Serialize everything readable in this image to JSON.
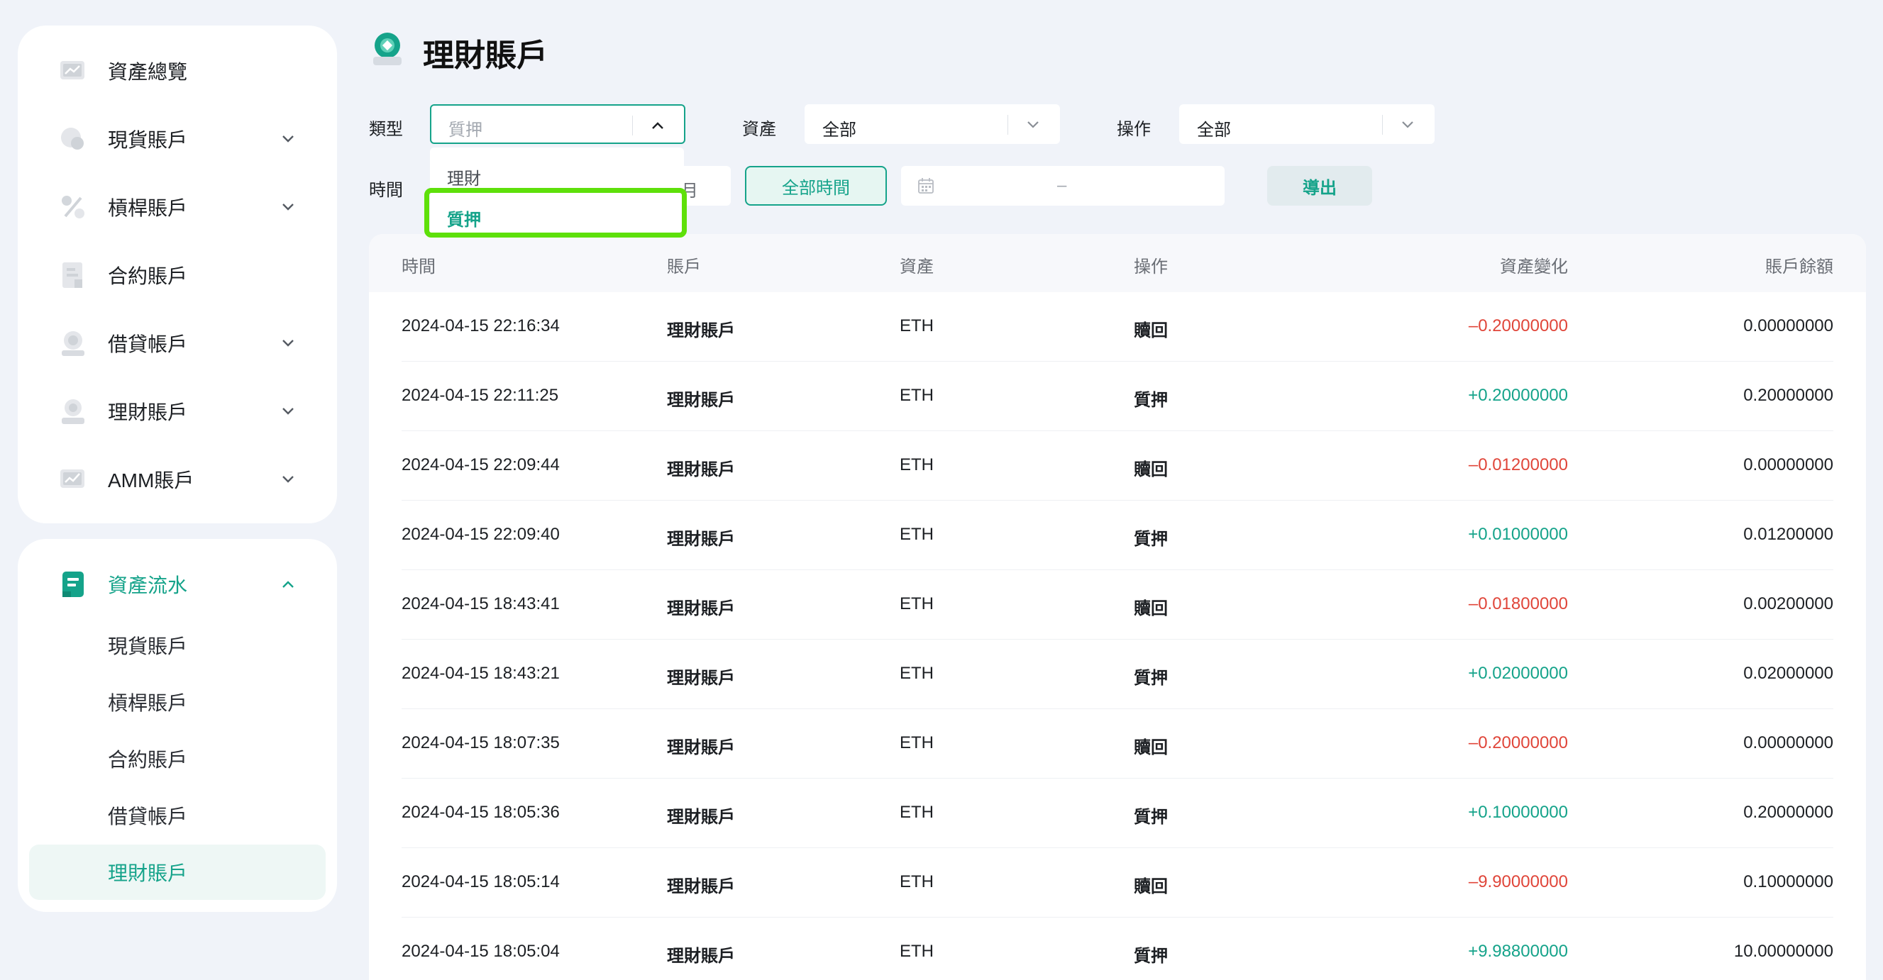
{
  "page": {
    "title": "理財賬戶"
  },
  "sidebar": {
    "top_items": [
      {
        "label": "資產總覽",
        "icon": "chart-board-icon",
        "has_chevron": false
      },
      {
        "label": "現貨賬戶",
        "icon": "coin-icon",
        "has_chevron": true
      },
      {
        "label": "槓桿賬戶",
        "icon": "percent-icon",
        "has_chevron": true
      },
      {
        "label": "合約賬戶",
        "icon": "document-icon",
        "has_chevron": false
      },
      {
        "label": "借貸帳戶",
        "icon": "lending-icon",
        "has_chevron": true
      },
      {
        "label": "理財賬戶",
        "icon": "wealth-icon",
        "has_chevron": true
      },
      {
        "label": "AMM賬戶",
        "icon": "amm-chart-icon",
        "has_chevron": true
      }
    ],
    "flow": {
      "label": "資產流水",
      "icon": "ledger-icon",
      "sub_items": [
        "現貨賬戶",
        "槓桿賬戶",
        "合約賬戶",
        "借貸帳戶",
        "理財賬戶"
      ],
      "active_sub": 4
    }
  },
  "filters": {
    "type_label": "類型",
    "type_value": "質押",
    "type_options": [
      "理財",
      "質押"
    ],
    "asset_label": "資產",
    "asset_value": "全部",
    "action_label": "操作",
    "action_value": "全部",
    "time_label": "時間",
    "month_partial": "月",
    "all_time_button": "全部時間",
    "date_separator": "–",
    "export_button": "導出"
  },
  "table": {
    "headers": [
      "時間",
      "賬戶",
      "資產",
      "操作",
      "資產變化",
      "賬戶餘額"
    ],
    "rows": [
      {
        "time": "2024-04-15 22:16:34",
        "account": "理財賬戶",
        "asset": "ETH",
        "action": "贖回",
        "change": "–0.20000000",
        "sign": "neg",
        "balance": "0.00000000"
      },
      {
        "time": "2024-04-15 22:11:25",
        "account": "理財賬戶",
        "asset": "ETH",
        "action": "質押",
        "change": "+0.20000000",
        "sign": "pos",
        "balance": "0.20000000"
      },
      {
        "time": "2024-04-15 22:09:44",
        "account": "理財賬戶",
        "asset": "ETH",
        "action": "贖回",
        "change": "–0.01200000",
        "sign": "neg",
        "balance": "0.00000000"
      },
      {
        "time": "2024-04-15 22:09:40",
        "account": "理財賬戶",
        "asset": "ETH",
        "action": "質押",
        "change": "+0.01000000",
        "sign": "pos",
        "balance": "0.01200000"
      },
      {
        "time": "2024-04-15 18:43:41",
        "account": "理財賬戶",
        "asset": "ETH",
        "action": "贖回",
        "change": "–0.01800000",
        "sign": "neg",
        "balance": "0.00200000"
      },
      {
        "time": "2024-04-15 18:43:21",
        "account": "理財賬戶",
        "asset": "ETH",
        "action": "質押",
        "change": "+0.02000000",
        "sign": "pos",
        "balance": "0.02000000"
      },
      {
        "time": "2024-04-15 18:07:35",
        "account": "理財賬戶",
        "asset": "ETH",
        "action": "贖回",
        "change": "–0.20000000",
        "sign": "neg",
        "balance": "0.00000000"
      },
      {
        "time": "2024-04-15 18:05:36",
        "account": "理財賬戶",
        "asset": "ETH",
        "action": "質押",
        "change": "+0.10000000",
        "sign": "pos",
        "balance": "0.20000000"
      },
      {
        "time": "2024-04-15 18:05:14",
        "account": "理財賬戶",
        "asset": "ETH",
        "action": "贖回",
        "change": "–9.90000000",
        "sign": "neg",
        "balance": "0.10000000"
      },
      {
        "time": "2024-04-15 18:05:04",
        "account": "理財賬戶",
        "asset": "ETH",
        "action": "質押",
        "change": "+9.98800000",
        "sign": "pos",
        "balance": "10.00000000"
      }
    ]
  },
  "colors": {
    "accent": "#15a38a",
    "negative": "#e0463a",
    "highlight": "#5ee00a",
    "background": "#f0f3f9"
  }
}
